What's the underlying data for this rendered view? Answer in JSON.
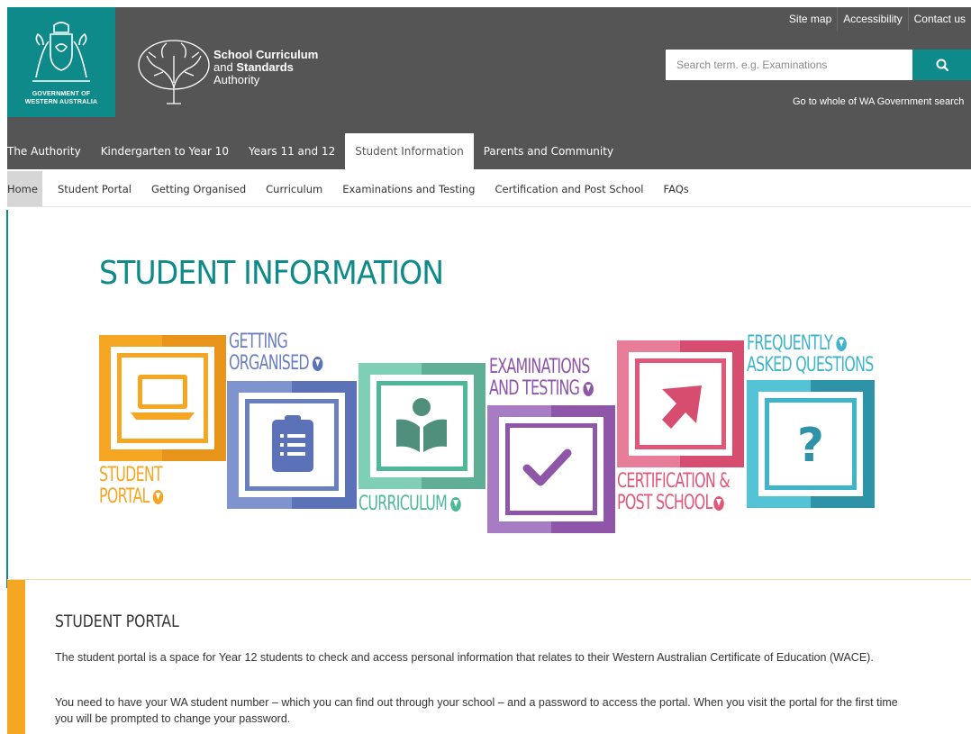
{
  "colors": {
    "teal": "#0e8a8a",
    "header_grey": "#555555",
    "student_portal": "#f5a623",
    "getting_organised": "#6a7fbf",
    "curriculum": "#4fb89a",
    "examinations": "#8e55a8",
    "certification": "#e0577a",
    "faq": "#3fb5c9"
  },
  "header": {
    "gov_line1": "GOVERNMENT OF",
    "gov_line2": "WESTERN AUSTRALIA",
    "scsa_line1": "School Curriculum",
    "scsa_line2_prefix": "and ",
    "scsa_line2_bold": "Standards",
    "scsa_line3": "Authority",
    "utility_links": [
      "Site map",
      "Accessibility",
      "Contact us"
    ],
    "search_placeholder": "Search term. e.g. Examinations",
    "search_icon": "search-icon",
    "wa_gov_link": "Go to whole of WA Government search"
  },
  "main_nav": [
    "The Authority",
    "Kindergarten to Year 10",
    "Years 11 and 12",
    "Student Information",
    "Parents and Community"
  ],
  "main_nav_active": "Student Information",
  "sub_nav": [
    "Home",
    "Student Portal",
    "Getting Organised",
    "Curriculum",
    "Examinations and Testing",
    "Certification and Post School",
    "FAQs"
  ],
  "sub_nav_active": "Home",
  "hero": {
    "title": "STUDENT INFORMATION",
    "tiles": [
      {
        "name": "student-portal",
        "line1": "STUDENT",
        "line2": "PORTAL",
        "icon": "laptop-icon"
      },
      {
        "name": "getting-organised",
        "line1": "GETTING",
        "line2": "ORGANISED",
        "icon": "clipboard-icon"
      },
      {
        "name": "curriculum",
        "line1": "CURRICULUM",
        "icon": "reading-person-icon"
      },
      {
        "name": "examinations",
        "line1": "EXAMINATIONS",
        "line2": "AND TESTING",
        "icon": "checkmark-icon"
      },
      {
        "name": "certification",
        "line1": "CERTIFICATION &",
        "line2": "POST SCHOOL",
        "icon": "arrow-icon"
      },
      {
        "name": "faq",
        "line1": "FREQUENTLY",
        "line2": "ASKED QUESTIONS",
        "icon": "question-icon"
      }
    ]
  },
  "section": {
    "title": "STUDENT PORTAL",
    "para1": "The student portal is a space for Year 12 students to check and access personal information that relates to their Western Australian Certificate of Education (WACE).",
    "para2": "You need to have your WA student number – which you can find out through your school – and a password to access the portal. When you visit the portal for the first time you will be prompted to change your password."
  }
}
